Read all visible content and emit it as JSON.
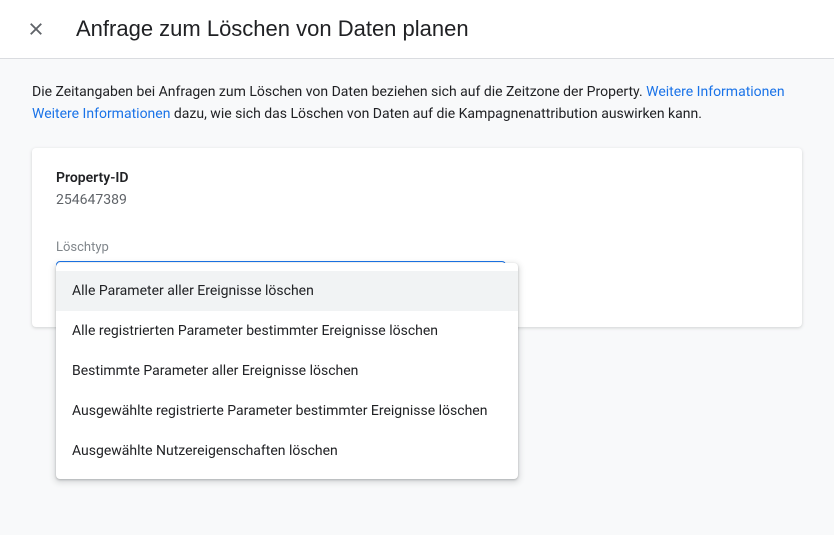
{
  "header": {
    "title": "Anfrage zum Löschen von Daten planen"
  },
  "info": {
    "line1_text": "Die Zeitangaben bei Anfragen zum Löschen von Daten beziehen sich auf die Zeitzone der Property. ",
    "line1_link": "Weitere Informationen",
    "line2_link": "Weitere Informationen",
    "line2_text": " dazu, wie sich das Löschen von Daten auf die Kampagnenattribution auswirken kann."
  },
  "card": {
    "property_label": "Property-ID",
    "property_value": "254647389",
    "select_label": "Löschtyp"
  },
  "dropdown": {
    "options": [
      "Alle Parameter aller Ereignisse löschen",
      "Alle registrierten Parameter bestimmter Ereignisse löschen",
      "Bestimmte Parameter aller Ereignisse löschen",
      "Ausgewählte registrierte Parameter bestimmter Ereignisse löschen",
      "Ausgewählte Nutzereigenschaften löschen"
    ]
  }
}
